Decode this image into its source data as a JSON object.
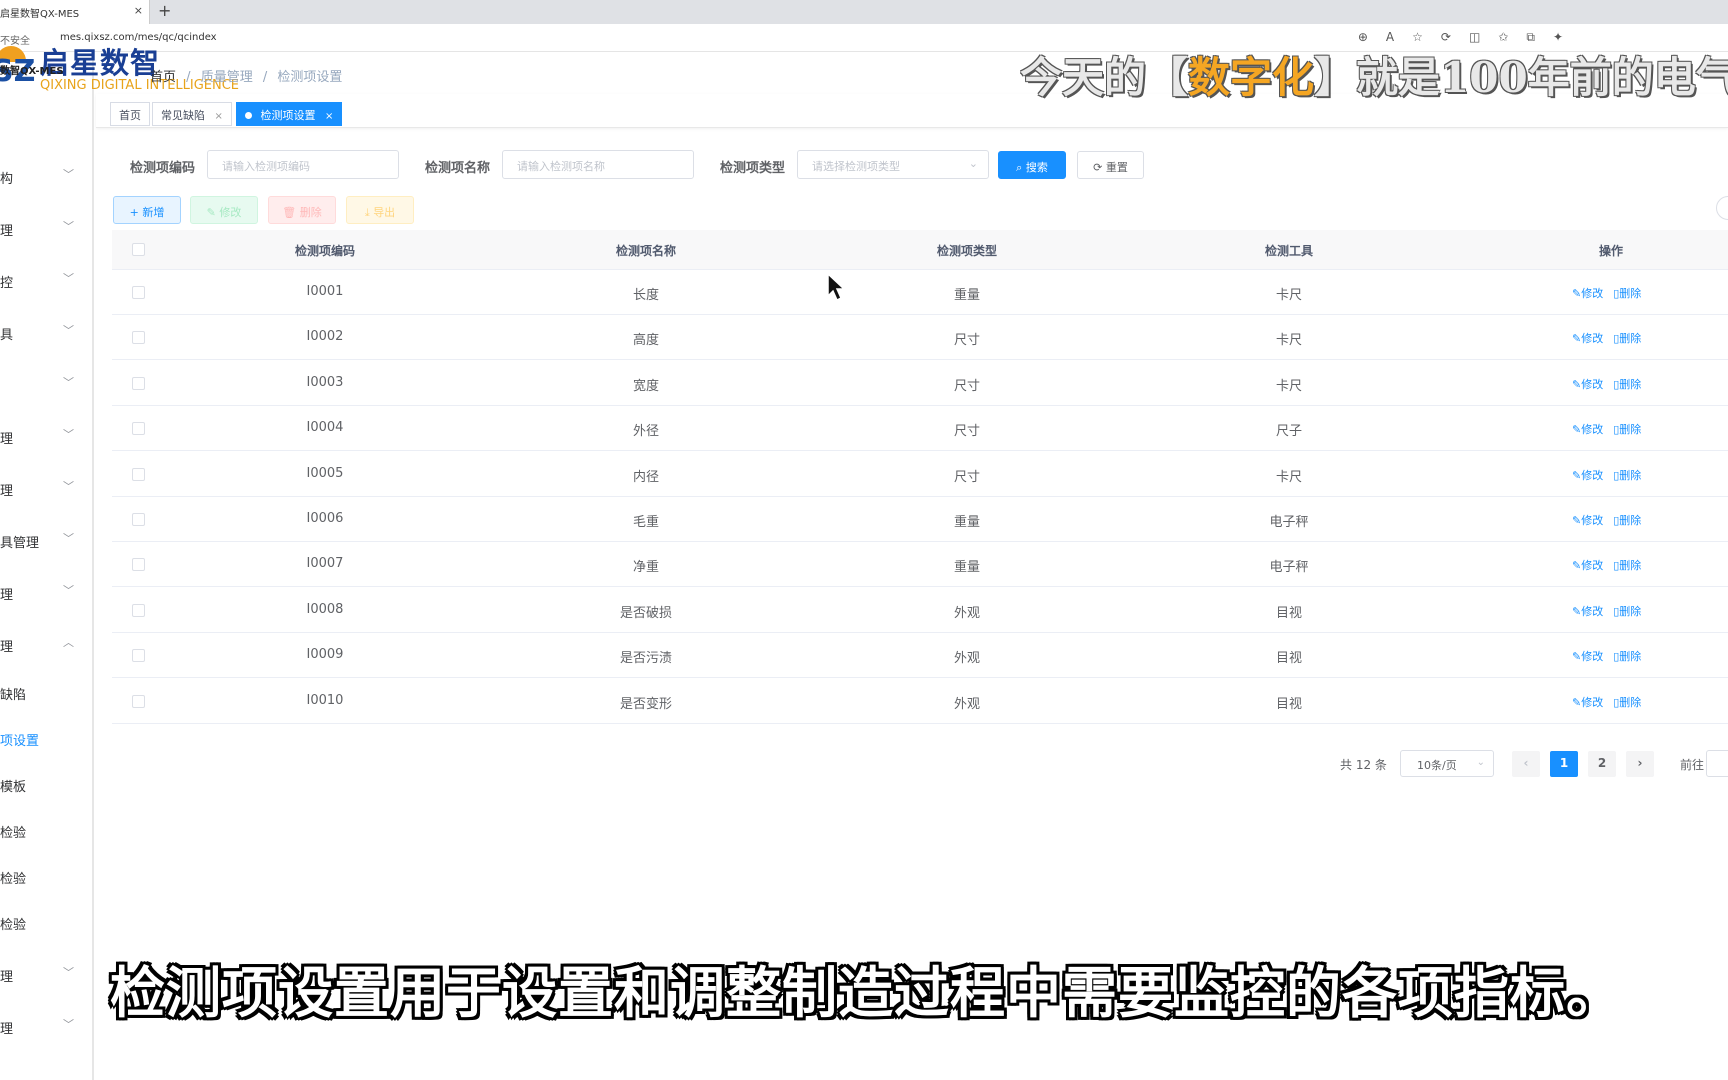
{
  "browser": {
    "tab_title": "启星数智QX-MES",
    "tab_close": "×",
    "new_tab": "+",
    "security": "不安全",
    "url": "mes.qixsz.com/mes/qc/qcindex"
  },
  "logo": {
    "cn": "启星数智",
    "en": "QIXING DIGITAL INTELLIGENCE",
    "app": "数智QX-MES",
    "mark": "SZ"
  },
  "sidebar": {
    "items": [
      {
        "label": "构",
        "chevron": "down"
      },
      {
        "label": "理",
        "chevron": "down"
      },
      {
        "label": "控",
        "chevron": "down"
      },
      {
        "label": "具",
        "chevron": "down"
      },
      {
        "label": "",
        "chevron": "down"
      },
      {
        "label": "理",
        "chevron": "down"
      },
      {
        "label": "理",
        "chevron": "down"
      },
      {
        "label": "具管理",
        "chevron": "down"
      },
      {
        "label": "理",
        "chevron": "down"
      },
      {
        "label": "理",
        "chevron": "up"
      },
      {
        "label": "缺陷",
        "chevron": ""
      },
      {
        "label": "项设置",
        "chevron": "",
        "active": true
      },
      {
        "label": "模板",
        "chevron": ""
      },
      {
        "label": "检验",
        "chevron": ""
      },
      {
        "label": "检验",
        "chevron": ""
      },
      {
        "label": "检验",
        "chevron": ""
      },
      {
        "label": "理",
        "chevron": "down"
      },
      {
        "label": "理",
        "chevron": "down"
      }
    ]
  },
  "breadcrumb": [
    "首页",
    "/",
    "质量管理",
    "/",
    "检测项设置"
  ],
  "tags": [
    {
      "label": "首页"
    },
    {
      "label": "常见缺陷",
      "close": "×"
    },
    {
      "label": "检测项设置",
      "close": "×",
      "active": true
    }
  ],
  "overlay_title": {
    "before": "今天的【",
    "highlight": "数字化",
    "after": "】就是100年前的电气"
  },
  "search": {
    "code_label": "检测项编码",
    "code_placeholder": "请输入检测项编码",
    "name_label": "检测项名称",
    "name_placeholder": "请输入检测项名称",
    "type_label": "检测项类型",
    "type_placeholder": "请选择检测项类型",
    "search_btn": "搜索",
    "reset_btn": "重置"
  },
  "toolbar": {
    "add": "新增",
    "edit": "修改",
    "delete": "删除",
    "export": "导出"
  },
  "table": {
    "headers": [
      "检测项编码",
      "检测项名称",
      "检测项类型",
      "检测工具",
      "操作"
    ],
    "op_edit": "修改",
    "op_delete": "删除",
    "rows": [
      [
        "I0001",
        "长度",
        "重量",
        "卡尺"
      ],
      [
        "I0002",
        "高度",
        "尺寸",
        "卡尺"
      ],
      [
        "I0003",
        "宽度",
        "尺寸",
        "卡尺"
      ],
      [
        "I0004",
        "外径",
        "尺寸",
        "尺子"
      ],
      [
        "I0005",
        "内径",
        "尺寸",
        "卡尺"
      ],
      [
        "I0006",
        "毛重",
        "重量",
        "电子秤"
      ],
      [
        "I0007",
        "净重",
        "重量",
        "电子秤"
      ],
      [
        "I0008",
        "是否破损",
        "外观",
        "目视"
      ],
      [
        "I0009",
        "是否污渍",
        "外观",
        "目视"
      ],
      [
        "I0010",
        "是否变形",
        "外观",
        "目视"
      ]
    ]
  },
  "pagination": {
    "total": "共 12 条",
    "page_size": "10条/页",
    "prev": "‹",
    "pages": [
      "1",
      "2"
    ],
    "next": "›",
    "goto": "前往"
  },
  "subtitle": "检测项设置用于设置和调整制造过程中需要监控的各项指标。",
  "colors": {
    "primary": "#1890ff",
    "success": "#13ce66",
    "danger": "#ff4949",
    "warning": "#ffba00",
    "logo_blue": "#1a3f94",
    "logo_orange": "#e8a31a"
  }
}
